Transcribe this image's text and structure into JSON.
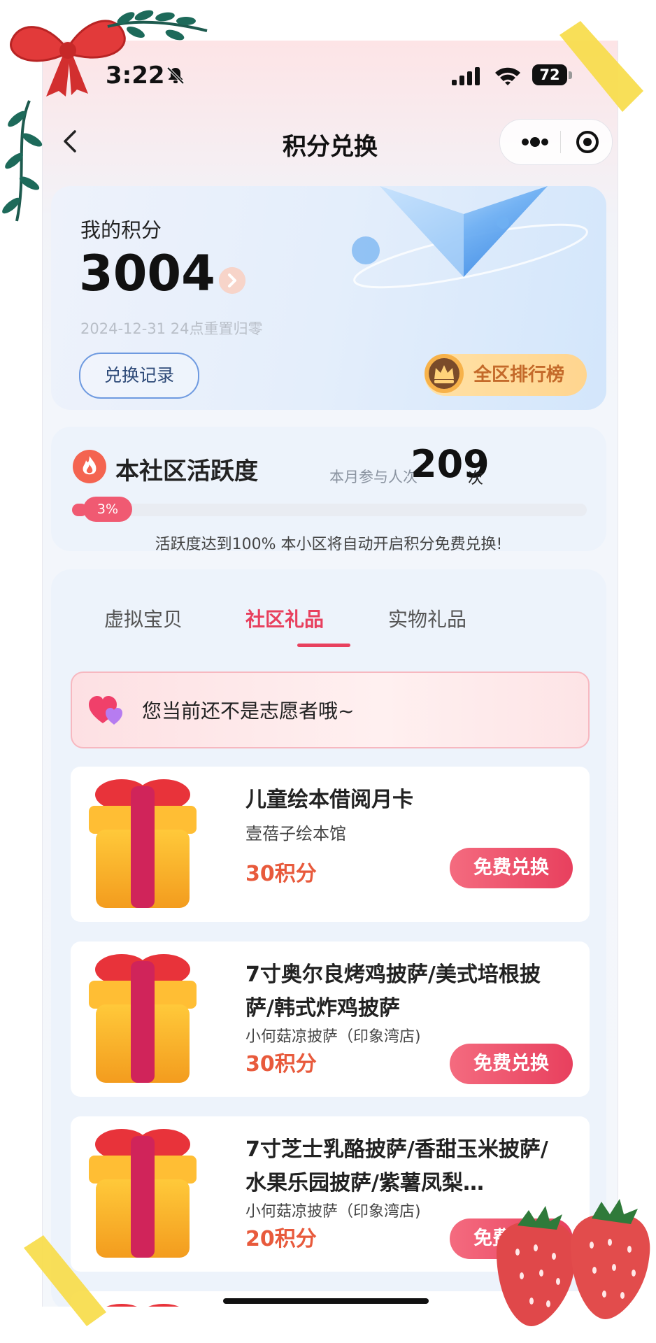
{
  "status_bar": {
    "time": "3:22",
    "battery": "72"
  },
  "nav": {
    "title": "积分兑换"
  },
  "points": {
    "label": "我的积分",
    "value": "3004",
    "expire_note": "2024-12-31 24点重置归零",
    "history_button": "兑换记录",
    "leaderboard_button": "全区排行榜"
  },
  "activity": {
    "title": "本社区活跃度",
    "participants_label": "本月参与人次",
    "participants_value": "209",
    "participants_unit": "次",
    "progress_label": "3%",
    "progress_fraction": 0.03,
    "note": "活跃度达到100% 本小区将自动开启积分免费兑换!"
  },
  "tabs": [
    {
      "label": "虚拟宝贝",
      "active": false
    },
    {
      "label": "社区礼品",
      "active": true
    },
    {
      "label": "实物礼品",
      "active": false
    }
  ],
  "notice": {
    "text": "您当前还不是志愿者哦~"
  },
  "gifts": [
    {
      "name": "儿童绘本借阅月卡",
      "shop": "壹蓓子绘本馆",
      "points": "30积分",
      "button": "免费兑换"
    },
    {
      "name": "7寸奥尔良烤鸡披萨/美式培根披萨/韩式炸鸡披萨",
      "shop": "小何菇凉披萨（印象湾店)",
      "points": "30积分",
      "button": "免费兑换"
    },
    {
      "name": "7寸芝士乳酪披萨/香甜玉米披萨/水果乐园披萨/紫薯凤梨…",
      "shop": "小何菇凉披萨（印象湾店)",
      "points": "20积分",
      "button": "免费兑换"
    }
  ],
  "colors": {
    "accent": "#e8405e",
    "points_text": "#e85a3c",
    "rank_text": "#c46a2a",
    "history_border": "#6e9ae0"
  }
}
